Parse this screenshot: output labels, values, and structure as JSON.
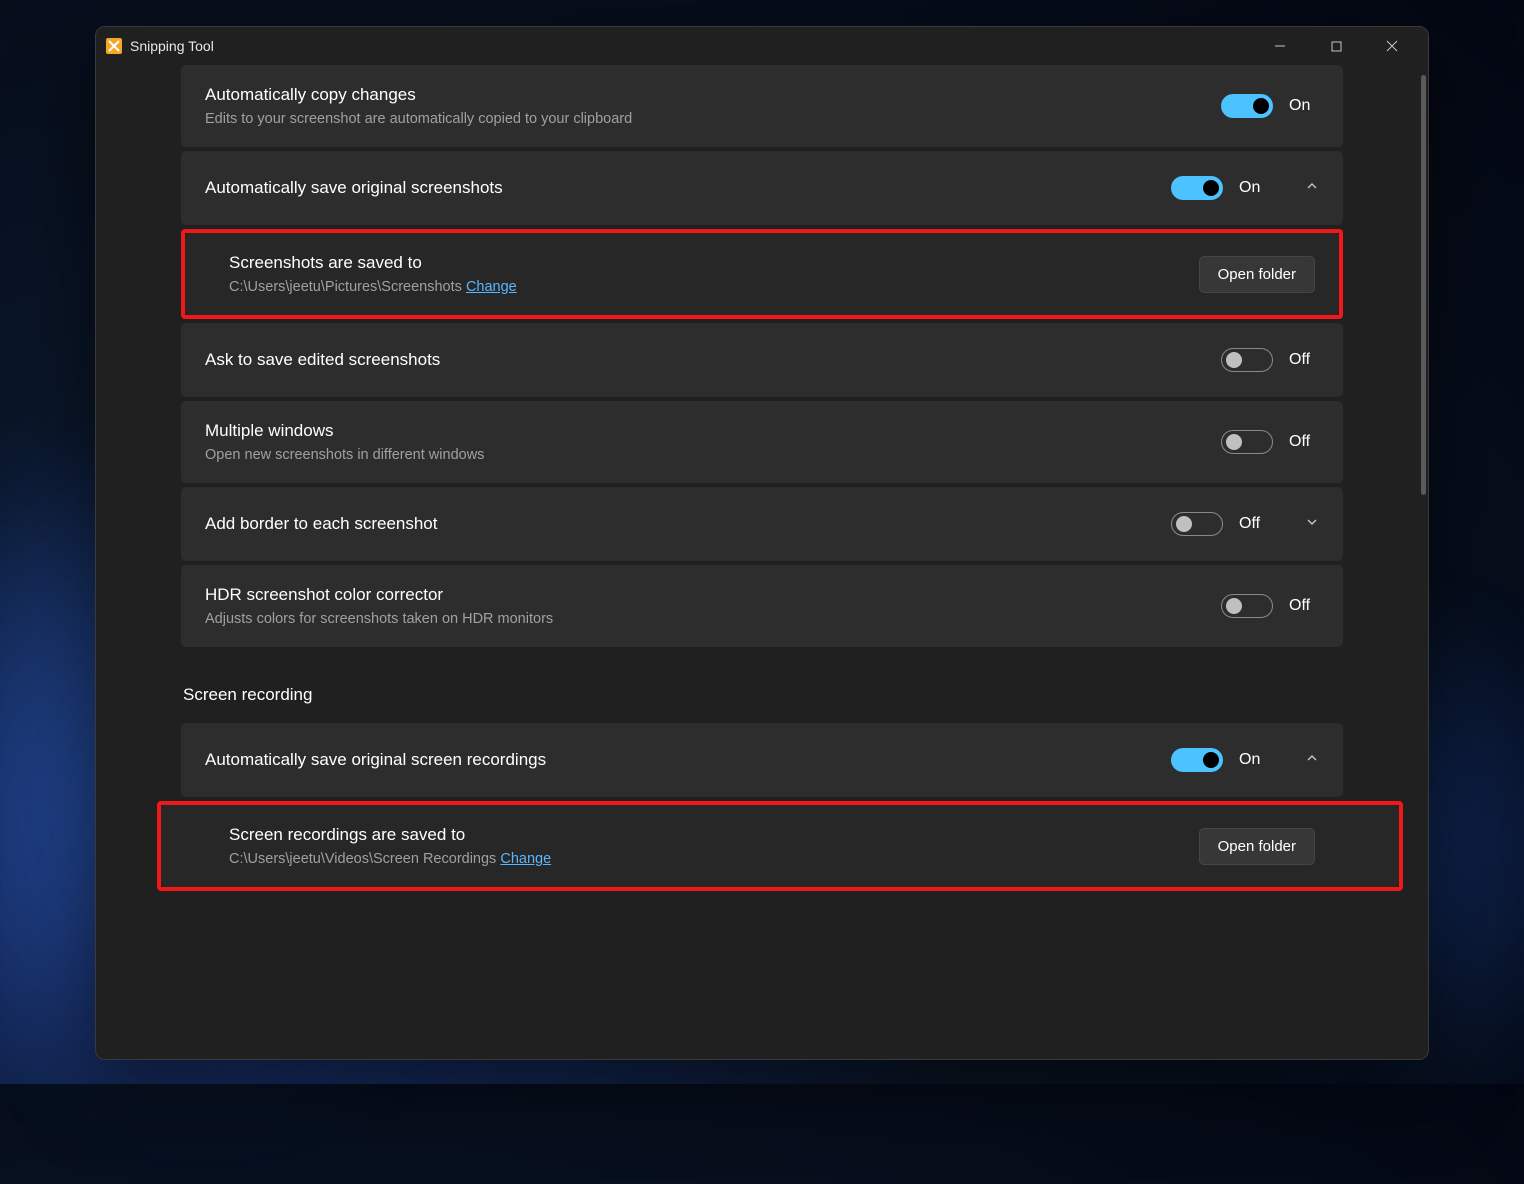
{
  "window": {
    "title": "Snipping Tool"
  },
  "settings": {
    "auto_copy": {
      "title": "Automatically copy changes",
      "subtitle": "Edits to your screenshot are automatically copied to your clipboard",
      "state": "On"
    },
    "auto_save_screenshots": {
      "title": "Automatically save original screenshots",
      "state": "On"
    },
    "screenshot_location": {
      "title": "Screenshots are saved to",
      "path": "C:\\Users\\jeetu\\Pictures\\Screenshots",
      "change": "Change",
      "open_folder": "Open folder"
    },
    "ask_save_edited": {
      "title": "Ask to save edited screenshots",
      "state": "Off"
    },
    "multiple_windows": {
      "title": "Multiple windows",
      "subtitle": "Open new screenshots in different windows",
      "state": "Off"
    },
    "add_border": {
      "title": "Add border to each screenshot",
      "state": "Off"
    },
    "hdr_corrector": {
      "title": "HDR screenshot color corrector",
      "subtitle": "Adjusts colors for screenshots taken on HDR monitors",
      "state": "Off"
    },
    "section_recording": "Screen recording",
    "auto_save_recordings": {
      "title": "Automatically save original screen recordings",
      "state": "On"
    },
    "recording_location": {
      "title": "Screen recordings are saved to",
      "path": "C:\\Users\\jeetu\\Videos\\Screen Recordings",
      "change": "Change",
      "open_folder": "Open folder"
    }
  }
}
